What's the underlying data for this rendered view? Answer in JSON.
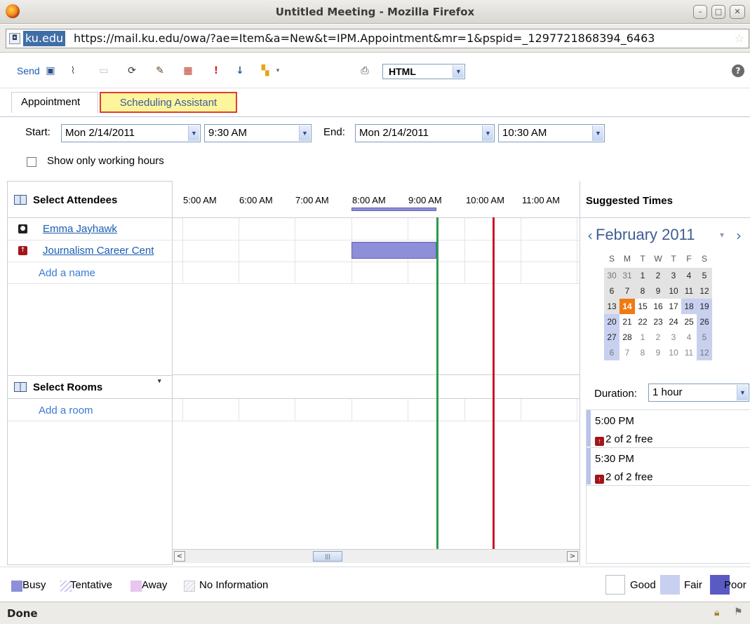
{
  "window": {
    "title": "Untitled Meeting - Mozilla Firefox"
  },
  "address_bar": {
    "domain": "ku.edu",
    "url": "https://mail.ku.edu/owa/?ae=Item&a=New&t=IPM.Appointment&mr=1&pspid=_1297721868394_6463"
  },
  "toolbar": {
    "send_label": "Send",
    "format_value": "HTML"
  },
  "tabs": {
    "appointment": "Appointment",
    "scheduling_assistant": "Scheduling Assistant"
  },
  "time_row": {
    "start_label": "Start:",
    "start_date": "Mon 2/14/2011",
    "start_time": "9:30 AM",
    "end_label": "End:",
    "end_date": "Mon 2/14/2011",
    "end_time": "10:30 AM",
    "working_hours_label": "Show only working hours"
  },
  "attendees": {
    "header": "Select Attendees",
    "items": [
      {
        "name": "Emma Jayhawk"
      },
      {
        "name": "Journalism Career Cent"
      }
    ],
    "add_label": "Add a name"
  },
  "rooms": {
    "header": "Select Rooms",
    "add_label": "Add a room"
  },
  "grid": {
    "hours": [
      "5:00 AM",
      "6:00 AM",
      "7:00 AM",
      "8:00 AM",
      "9:00 AM",
      "10:00 AM",
      "11:00 AM"
    ]
  },
  "suggested": {
    "header": "Suggested Times",
    "month": "February 2011",
    "weekdays": [
      "S",
      "M",
      "T",
      "W",
      "T",
      "F",
      "S"
    ],
    "weeks": [
      [
        "30",
        "31",
        "1",
        "2",
        "3",
        "4",
        "5"
      ],
      [
        "6",
        "7",
        "8",
        "9",
        "10",
        "11",
        "12"
      ],
      [
        "13",
        "14",
        "15",
        "16",
        "17",
        "18",
        "19"
      ],
      [
        "20",
        "21",
        "22",
        "23",
        "24",
        "25",
        "26"
      ],
      [
        "27",
        "28",
        "1",
        "2",
        "3",
        "4",
        "5"
      ],
      [
        "6",
        "7",
        "8",
        "9",
        "10",
        "11",
        "12"
      ]
    ],
    "duration_label": "Duration:",
    "duration_value": "1 hour",
    "times": [
      {
        "time": "5:00 PM",
        "free": "2 of 2 free"
      },
      {
        "time": "5:30 PM",
        "free": "2 of 2 free"
      }
    ]
  },
  "legend": {
    "busy": "Busy",
    "tentative": "Tentative",
    "away": "Away",
    "no_info": "No Information",
    "good": "Good",
    "fair": "Fair",
    "poor": "Poor"
  },
  "status": {
    "text": "Done"
  },
  "colors": {
    "busy": "#8e8fd9",
    "start_line": "#2e9a4f",
    "end_line": "#c8162a",
    "today": "#f07a12",
    "tab_highlight": "#fdf59c"
  }
}
